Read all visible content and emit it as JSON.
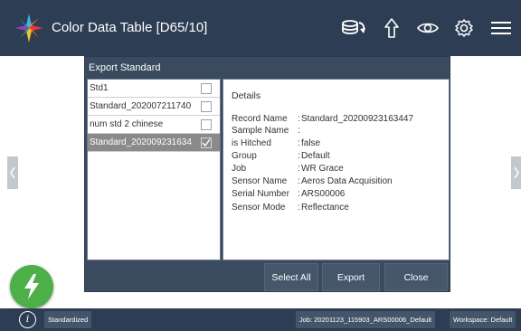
{
  "header": {
    "title": "Color Data Table [D65/10]",
    "icons": [
      "app-logo-icon",
      "cloud-sync-icon",
      "upload-arrow-icon",
      "eye-icon",
      "gear-icon",
      "menu-icon"
    ]
  },
  "dialog": {
    "title": "Export Standard",
    "list": [
      {
        "label": "Std1",
        "checked": false,
        "selected": false
      },
      {
        "label": "Standard_202007211740",
        "checked": false,
        "selected": false
      },
      {
        "label": "num std 2 chinese",
        "checked": false,
        "selected": false
      },
      {
        "label": "Standard_202009231634",
        "checked": true,
        "selected": true
      }
    ],
    "details": {
      "heading": "Details",
      "rows": [
        {
          "key": "Record Name",
          "value": "Standard_20200923163447"
        },
        {
          "key": "Sample Name",
          "value": ""
        },
        {
          "key": "is Hitched",
          "value": "false"
        },
        {
          "key": "Group",
          "value": "Default"
        },
        {
          "key": "Job",
          "value": "WR Grace"
        },
        {
          "key": "Sensor Name",
          "value": "Aeros Data Acquisition"
        },
        {
          "key": "Serial Number",
          "value": "ARS00006"
        },
        {
          "key": "Sensor Mode",
          "value": "Reflectance"
        }
      ]
    },
    "buttons": {
      "select_all": "Select All",
      "export": "Export",
      "close": "Close"
    }
  },
  "statusbar": {
    "info_icon": "i",
    "standardized": "Standardized",
    "job": "Job: 20201123_115903_ARS00006_Default",
    "workspace": "Workspace: Default"
  },
  "colors": {
    "header_bg": "#2d3d53",
    "dialog_bg": "#3a4a5f",
    "fab_green": "#4caf48",
    "selected_row": "#8a8a8a"
  }
}
